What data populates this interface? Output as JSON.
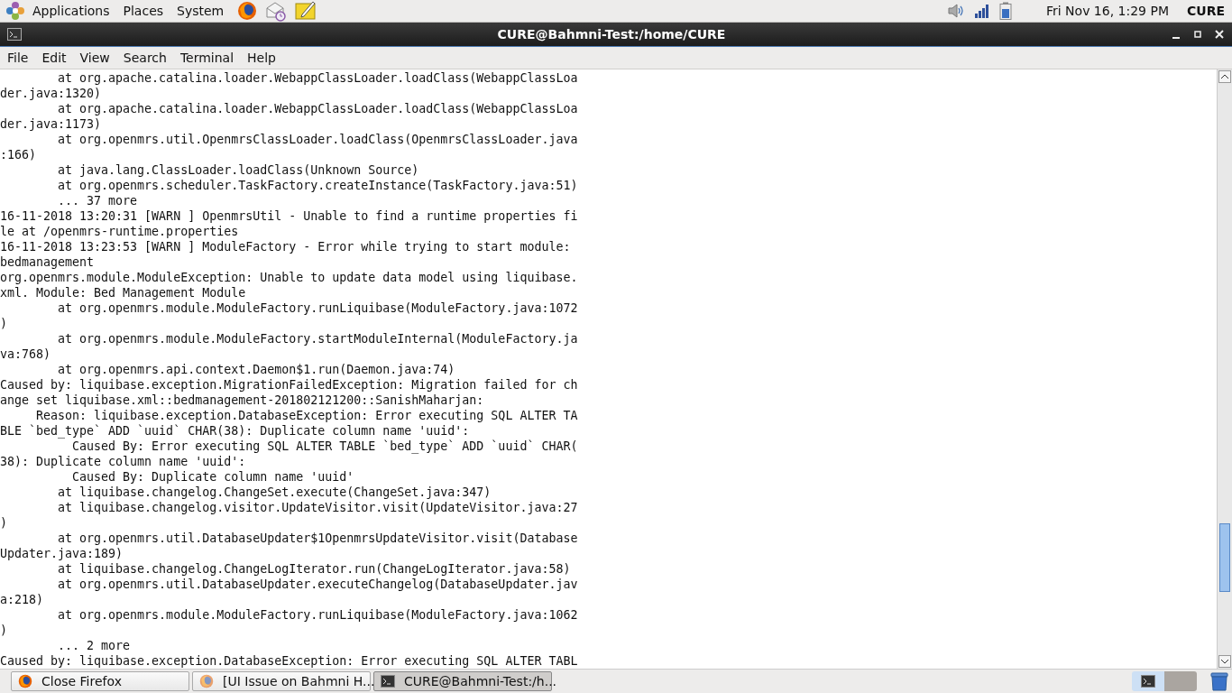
{
  "top_panel": {
    "menus": [
      "Applications",
      "Places",
      "System"
    ],
    "clock": "Fri Nov 16,  1:29 PM",
    "user": "CURE"
  },
  "window": {
    "title": "CURE@Bahmni-Test:/home/CURE"
  },
  "menu_bar": [
    "File",
    "Edit",
    "View",
    "Search",
    "Terminal",
    "Help"
  ],
  "terminal": {
    "lines": [
      "        at org.apache.catalina.loader.WebappClassLoader.loadClass(WebappClassLoa",
      "der.java:1320)",
      "        at org.apache.catalina.loader.WebappClassLoader.loadClass(WebappClassLoa",
      "der.java:1173)",
      "        at org.openmrs.util.OpenmrsClassLoader.loadClass(OpenmrsClassLoader.java",
      ":166)",
      "        at java.lang.ClassLoader.loadClass(Unknown Source)",
      "        at org.openmrs.scheduler.TaskFactory.createInstance(TaskFactory.java:51)",
      "        ... 37 more",
      "16-11-2018 13:20:31 [WARN ] OpenmrsUtil - Unable to find a runtime properties fi",
      "le at /openmrs-runtime.properties",
      "16-11-2018 13:23:53 [WARN ] ModuleFactory - Error while trying to start module:",
      "bedmanagement",
      "org.openmrs.module.ModuleException: Unable to update data model using liquibase.",
      "xml. Module: Bed Management Module",
      "        at org.openmrs.module.ModuleFactory.runLiquibase(ModuleFactory.java:1072",
      ")",
      "        at org.openmrs.module.ModuleFactory.startModuleInternal(ModuleFactory.ja",
      "va:768)",
      "        at org.openmrs.api.context.Daemon$1.run(Daemon.java:74)",
      "Caused by: liquibase.exception.MigrationFailedException: Migration failed for ch",
      "ange set liquibase.xml::bedmanagement-201802121200::SanishMaharjan:",
      "     Reason: liquibase.exception.DatabaseException: Error executing SQL ALTER TA",
      "BLE `bed_type` ADD `uuid` CHAR(38): Duplicate column name 'uuid':",
      "          Caused By: Error executing SQL ALTER TABLE `bed_type` ADD `uuid` CHAR(",
      "38): Duplicate column name 'uuid':",
      "          Caused By: Duplicate column name 'uuid'",
      "        at liquibase.changelog.ChangeSet.execute(ChangeSet.java:347)",
      "        at liquibase.changelog.visitor.UpdateVisitor.visit(UpdateVisitor.java:27",
      ")",
      "        at org.openmrs.util.DatabaseUpdater$1OpenmrsUpdateVisitor.visit(Database",
      "Updater.java:189)",
      "        at liquibase.changelog.ChangeLogIterator.run(ChangeLogIterator.java:58)",
      "        at org.openmrs.util.DatabaseUpdater.executeChangelog(DatabaseUpdater.jav",
      "a:218)",
      "        at org.openmrs.module.ModuleFactory.runLiquibase(ModuleFactory.java:1062",
      ")",
      "        ... 2 more",
      "Caused by: liquibase.exception.DatabaseException: Error executing SQL ALTER TABL"
    ]
  },
  "taskbar": [
    {
      "kind": "firefox",
      "label": "Close Firefox",
      "selected": false
    },
    {
      "kind": "firefox-faded",
      "label": "[UI Issue on Bahmni H...",
      "selected": false
    },
    {
      "kind": "terminal",
      "label": "CURE@Bahmni-Test:/h...",
      "selected": true
    }
  ]
}
